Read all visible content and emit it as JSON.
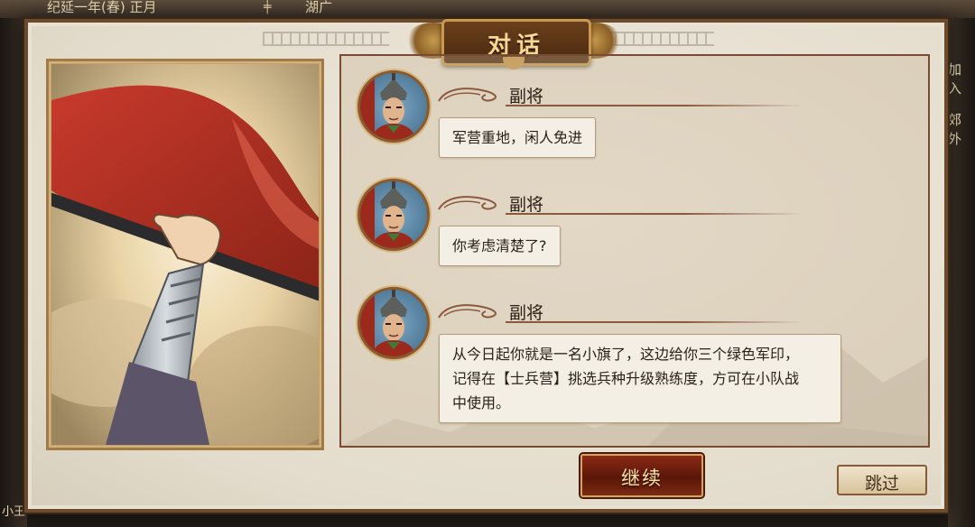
{
  "topbar": {
    "date": "纪延一年(春) 正月",
    "region": "湖广"
  },
  "side": {
    "right_top": "加入",
    "right_second": "郊外",
    "left_bottom": "小王"
  },
  "dialog": {
    "title": "对话"
  },
  "messages": [
    {
      "speaker": "副将",
      "text": "军营重地，闲人免进"
    },
    {
      "speaker": "副将",
      "text": "你考虑清楚了?"
    },
    {
      "speaker": "副将",
      "text_lines": [
        "从今日起你就是一名小旗了，这边给你三个绿色军印，",
        "记得在【士兵营】挑选兵种升级熟练度，方可在小队战",
        "中使用。"
      ]
    }
  ],
  "buttons": {
    "continue": "继续",
    "skip": "跳过"
  },
  "icons": {
    "speaker_avatar": "soldier-portrait-icon",
    "illustration": "raised-banner-illustration",
    "title_ornament": "dragon-ornament-icon"
  },
  "colors": {
    "frame": "#6b4a2d",
    "continue_bg": "#5b1608",
    "title_text": "#f6d894",
    "banner_red": "#b73226"
  }
}
